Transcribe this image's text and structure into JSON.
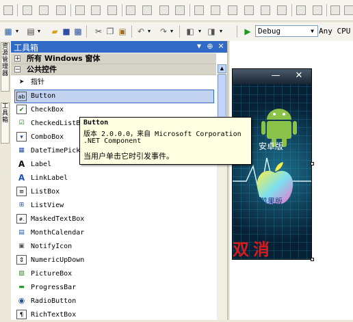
{
  "config": {
    "selected": "Debug",
    "platform": "Any CPU"
  },
  "vertical_tabs": [
    "资源管理器",
    "工具箱"
  ],
  "toolbox": {
    "title": "工具箱",
    "pin_glyph": "⊕",
    "close_glyph": "✕",
    "group_windows_forms": "所有 Windows 窗体",
    "group_common": "公共控件",
    "items": [
      {
        "label": "指针",
        "icon": "pointer-icon",
        "glyph": "➤"
      },
      {
        "label": "Button",
        "icon": "button-icon",
        "glyph": "ab"
      },
      {
        "label": "CheckBox",
        "icon": "checkbox-icon",
        "glyph": "✔"
      },
      {
        "label": "CheckedListBox",
        "icon": "checked-list-icon",
        "glyph": "☑"
      },
      {
        "label": "ComboBox",
        "icon": "combobox-icon",
        "glyph": "▾"
      },
      {
        "label": "DateTimePicker",
        "icon": "datetime-icon",
        "glyph": "▦"
      },
      {
        "label": "Label",
        "icon": "label-icon",
        "glyph": "A"
      },
      {
        "label": "LinkLabel",
        "icon": "linklabel-icon",
        "glyph": "A"
      },
      {
        "label": "ListBox",
        "icon": "listbox-icon",
        "glyph": "≡"
      },
      {
        "label": "ListView",
        "icon": "listview-icon",
        "glyph": "⊞"
      },
      {
        "label": "MaskedTextBox",
        "icon": "maskedtextbox-icon",
        "glyph": "#."
      },
      {
        "label": "MonthCalendar",
        "icon": "calendar-icon",
        "glyph": "▤"
      },
      {
        "label": "NotifyIcon",
        "icon": "notifyicon-icon",
        "glyph": "▣"
      },
      {
        "label": "NumericUpDown",
        "icon": "numeric-updown-icon",
        "glyph": "⇕"
      },
      {
        "label": "PictureBox",
        "icon": "picturebox-icon",
        "glyph": "▨"
      },
      {
        "label": "ProgressBar",
        "icon": "progressbar-icon",
        "glyph": "▬"
      },
      {
        "label": "RadioButton",
        "icon": "radiobutton-icon",
        "glyph": "◉"
      },
      {
        "label": "RichTextBox",
        "icon": "richtextbox-icon",
        "glyph": "¶"
      }
    ]
  },
  "tooltip": {
    "title": "Button",
    "line1": "版本 2.0.0.0，来自 Microsoft Corporation",
    "line2": ".NET Component",
    "description": "当用户单击它时引发事件。"
  },
  "form_preview": {
    "android_label": "安卓版",
    "apple_label": "苹果版",
    "red_text": "双消",
    "minimize_glyph": "—",
    "close_glyph": "✕"
  }
}
